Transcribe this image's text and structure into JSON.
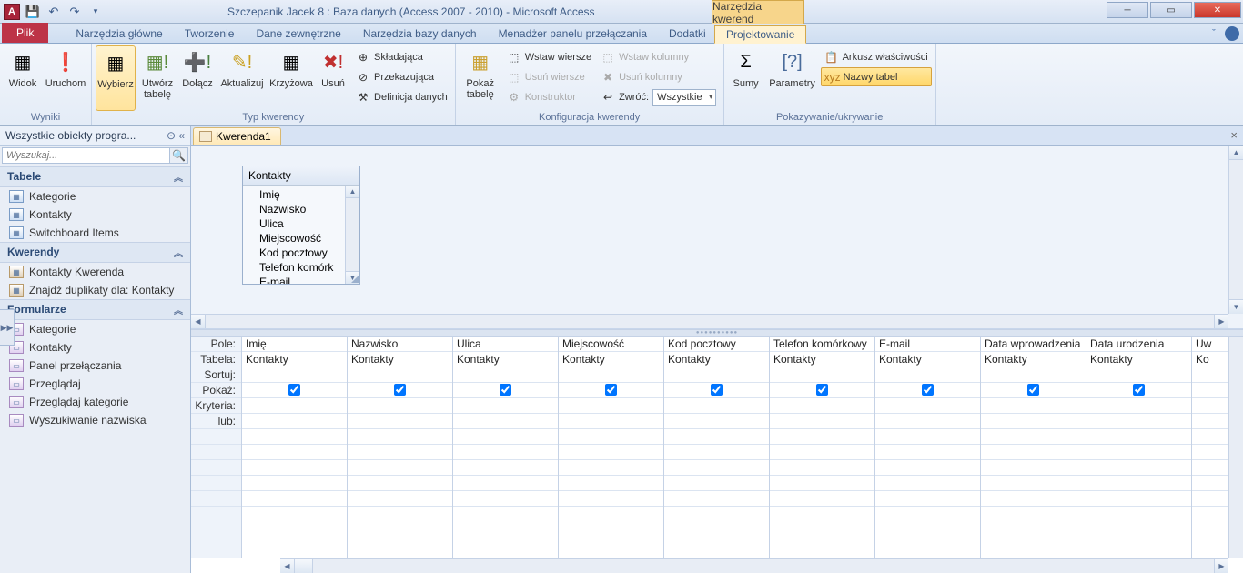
{
  "titlebar": {
    "app_icon_letter": "A",
    "title": "Szczepanik Jacek 8 : Baza danych (Access 2007 - 2010)  -  Microsoft Access",
    "context_title": "Narzędzia kwerend"
  },
  "tabs": {
    "file": "Plik",
    "items": [
      "Narzędzia główne",
      "Tworzenie",
      "Dane zewnętrzne",
      "Narzędzia bazy danych",
      "Menadżer panelu przełączania",
      "Dodatki"
    ],
    "context": "Projektowanie"
  },
  "ribbon": {
    "results": {
      "label": "Wyniki",
      "view": "Widok",
      "run": "Uruchom"
    },
    "query_type": {
      "label": "Typ kwerendy",
      "select": "Wybierz",
      "make_table": "Utwórz tabelę",
      "append": "Dołącz",
      "update": "Aktualizuj",
      "crosstab": "Krzyżowa",
      "delete": "Usuń",
      "union": "Składająca",
      "passthrough": "Przekazująca",
      "ddl": "Definicja danych"
    },
    "query_setup": {
      "label": "Konfiguracja kwerendy",
      "show_table": "Pokaż tabelę",
      "insert_rows": "Wstaw wiersze",
      "delete_rows": "Usuń wiersze",
      "builder": "Konstruktor",
      "insert_cols": "Wstaw kolumny",
      "delete_cols": "Usuń kolumny",
      "return": "Zwróć:",
      "return_value": "Wszystkie"
    },
    "show_hide": {
      "label": "Pokazywanie/ukrywanie",
      "totals": "Sumy",
      "params": "Parametry",
      "prop_sheet": "Arkusz właściwości",
      "table_names": "Nazwy tabel"
    }
  },
  "nav": {
    "header": "Wszystkie obiekty progra...",
    "search_placeholder": "Wyszukaj...",
    "groups": {
      "tables": {
        "label": "Tabele",
        "items": [
          "Kategorie",
          "Kontakty",
          "Switchboard Items"
        ]
      },
      "queries": {
        "label": "Kwerendy",
        "items": [
          "Kontakty Kwerenda",
          "Znajdź duplikaty dla: Kontakty"
        ]
      },
      "forms": {
        "label": "Formularze",
        "items": [
          "Kategorie",
          "Kontakty",
          "Panel przełączania",
          "Przeglądaj",
          "Przeglądaj kategorie",
          "Wyszukiwanie nazwiska"
        ]
      }
    }
  },
  "document": {
    "tab_label": "Kwerenda1",
    "table_box": {
      "title": "Kontakty",
      "fields": [
        "Imię",
        "Nazwisko",
        "Ulica",
        "Miejscowość",
        "Kod pocztowy",
        "Telefon komórk",
        "E-mail"
      ]
    },
    "grid": {
      "row_labels": [
        "Pole:",
        "Tabela:",
        "Sortuj:",
        "Pokaż:",
        "Kryteria:",
        "lub:"
      ],
      "columns": [
        {
          "field": "Imię",
          "table": "Kontakty",
          "show": true
        },
        {
          "field": "Nazwisko",
          "table": "Kontakty",
          "show": true
        },
        {
          "field": "Ulica",
          "table": "Kontakty",
          "show": true
        },
        {
          "field": "Miejscowość",
          "table": "Kontakty",
          "show": true
        },
        {
          "field": "Kod pocztowy",
          "table": "Kontakty",
          "show": true
        },
        {
          "field": "Telefon komórkowy",
          "table": "Kontakty",
          "show": true
        },
        {
          "field": "E-mail",
          "table": "Kontakty",
          "show": true
        },
        {
          "field": "Data wprowadzenia",
          "table": "Kontakty",
          "show": true
        },
        {
          "field": "Data urodzenia",
          "table": "Kontakty",
          "show": true
        }
      ],
      "partial_last": {
        "field": "Uw",
        "table": "Ko"
      }
    }
  }
}
